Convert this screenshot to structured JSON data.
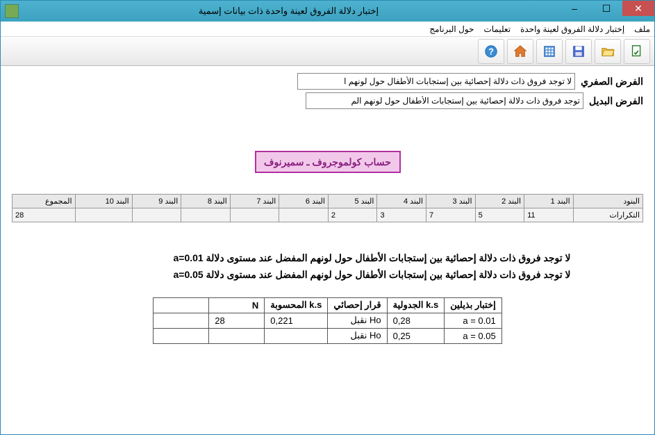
{
  "window": {
    "title": "إختبار دلالة الفروق لعينة واحدة ذات بيانات إسمية"
  },
  "menu": {
    "items": [
      "ملف",
      "إختبار دلالة الفروق لعينة واحدة",
      "تعليمات",
      "حول البرنامج"
    ]
  },
  "toolbar": {
    "icons": [
      "refresh-doc",
      "folder-open",
      "save",
      "keypad",
      "home",
      "help"
    ]
  },
  "hypotheses": {
    "nullLabel": "الفرض الصفري",
    "nullText": "لا توجد فروق ذات دلالة إحصائية بين إستجابات الأطفال حول لونهم ا",
    "altLabel": "الفرض البديل",
    "altText": "توجد فروق ذات دلالة إحصائية بين إستجابات الأطفال حول لونهم الم"
  },
  "calcButton": "حساب كولموجروف ـ سميرنوف",
  "grid": {
    "headers": [
      "البنود",
      "البند 1",
      "البند 2",
      "البند 3",
      "البند 4",
      "البند 5",
      "البند 6",
      "البند 7",
      "البند 8",
      "البند 9",
      "البند 10",
      "المجموع"
    ],
    "rowLabel": "التكرارات",
    "values": [
      "11",
      "5",
      "7",
      "3",
      "2",
      "",
      "",
      "",
      "",
      "",
      "28"
    ]
  },
  "summary": {
    "line1": "لا توجد فروق ذات دلالة إحصائية بين إستجابات الأطفال حول لونهم المفضل عند مستوى دلالة a=0.01",
    "line2": "لا توجد فروق ذات دلالة إحصائية بين إستجابات الأطفال حول لونهم المفضل عند مستوى دلالة a=0.05"
  },
  "results": {
    "headers": [
      "إختبار بذيلين",
      "k.s الجدولية",
      "قرار إحصائي",
      "k.s المحسوبة",
      "N",
      ""
    ],
    "rows": [
      {
        "alpha": "a = 0.01",
        "critical": "0,28",
        "decision": "Ho نقبل",
        "computed": "0,221",
        "n": "28",
        "blank": ""
      },
      {
        "alpha": "a = 0.05",
        "critical": "0,25",
        "decision": "Ho نقبل",
        "computed": "",
        "n": "",
        "blank": ""
      }
    ]
  }
}
